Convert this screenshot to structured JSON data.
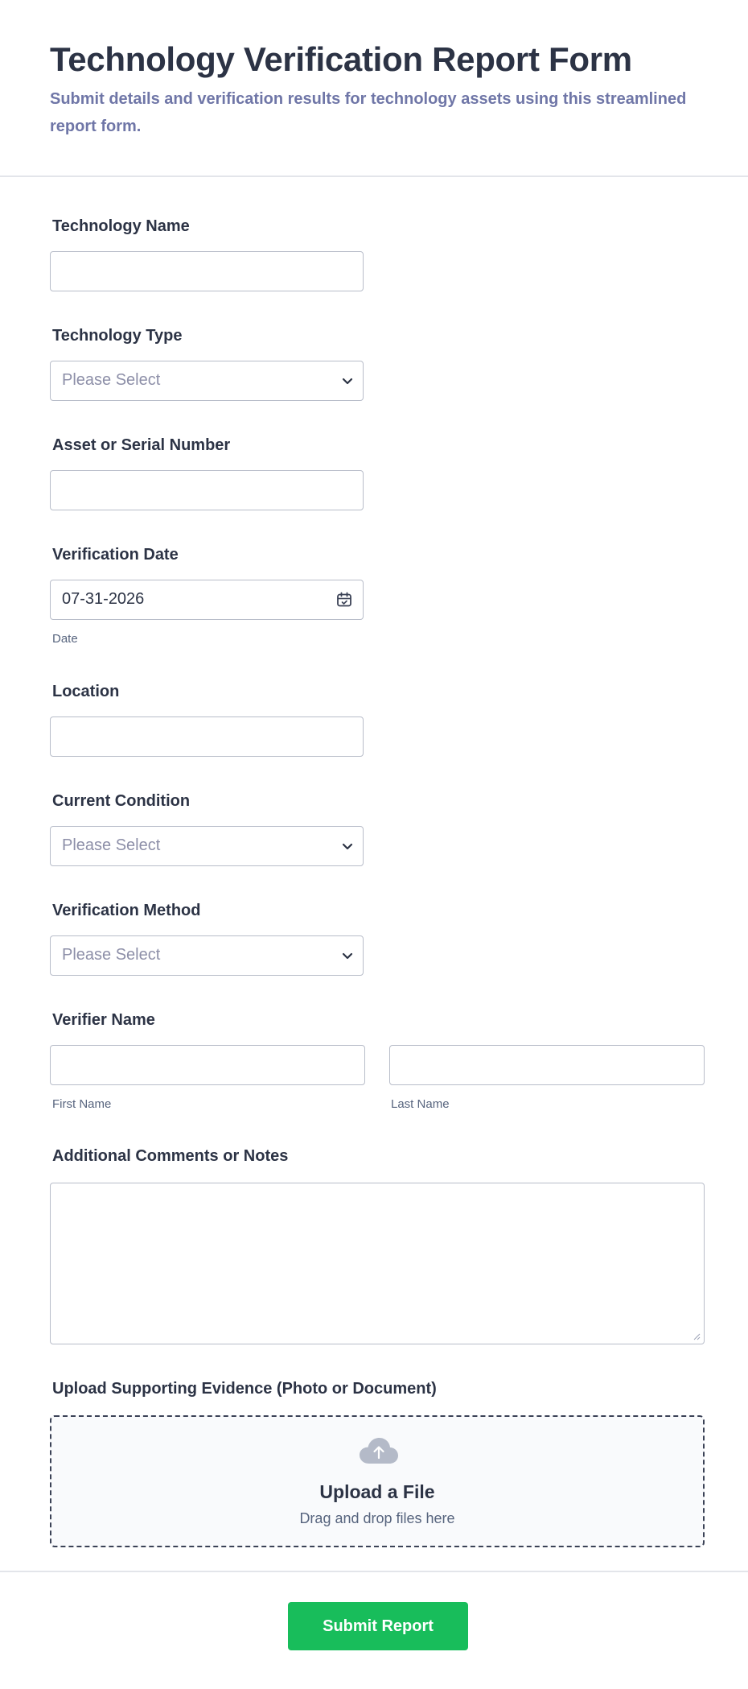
{
  "header": {
    "title": "Technology Verification Report Form",
    "subtitle": "Submit details and verification results for technology assets using this streamlined report form."
  },
  "fields": {
    "technology_name": {
      "label": "Technology Name",
      "value": ""
    },
    "technology_type": {
      "label": "Technology Type",
      "placeholder": "Please Select"
    },
    "asset_serial": {
      "label": "Asset or Serial Number",
      "value": ""
    },
    "verification_date": {
      "label": "Verification Date",
      "value": "07-31-2026",
      "sublabel": "Date"
    },
    "location": {
      "label": "Location",
      "value": ""
    },
    "current_condition": {
      "label": "Current Condition",
      "placeholder": "Please Select"
    },
    "verification_method": {
      "label": "Verification Method",
      "placeholder": "Please Select"
    },
    "verifier_name": {
      "label": "Verifier Name",
      "first_sublabel": "First Name",
      "last_sublabel": "Last Name"
    },
    "comments": {
      "label": "Additional Comments or Notes",
      "value": ""
    },
    "upload": {
      "label": "Upload Supporting Evidence (Photo or Document)",
      "title": "Upload a File",
      "subtitle": "Drag and drop files here"
    }
  },
  "submit": {
    "label": "Submit Report"
  },
  "icons": {
    "select": "chevron-down-icon",
    "date": "calendar-icon",
    "upload": "cloud-upload-icon"
  },
  "colors": {
    "accent": "#18bd5b",
    "text": "#2c3345",
    "muted": "#6f76a7",
    "border": "#b8bdc9"
  }
}
